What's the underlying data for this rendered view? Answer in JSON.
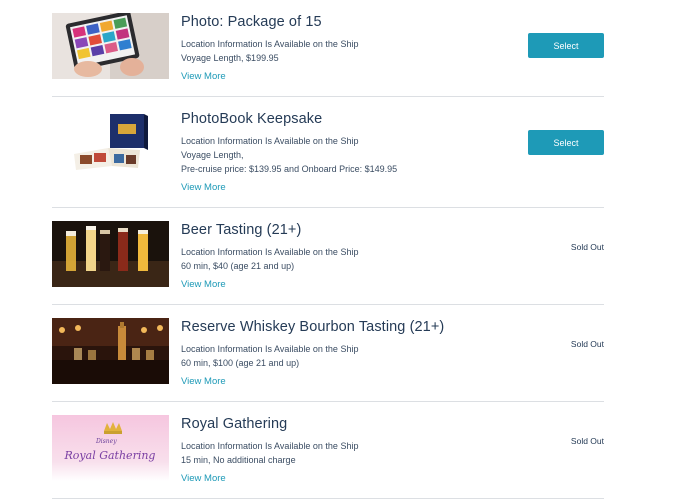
{
  "items": [
    {
      "title": "Photo: Package of 15",
      "location": "Location Information Is Available on the Ship",
      "detail1": "Voyage Length, $199.95",
      "view_more": "View More",
      "action": "Select",
      "thumb_icon": "tablet-photos-image"
    },
    {
      "title": "PhotoBook Keepsake",
      "location": "Location Information Is Available on the Ship",
      "detail1": "Voyage Length,",
      "detail2": "Pre-cruise price: $139.95 and Onboard Price: $149.95",
      "view_more": "View More",
      "action": "Select",
      "thumb_icon": "photobook-image"
    },
    {
      "title": "Beer Tasting (21+)",
      "location": "Location Information Is Available on the Ship",
      "detail1": "60 min, $40 (age 21 and up)",
      "view_more": "View More",
      "status": "Sold Out",
      "thumb_icon": "beer-glasses-image"
    },
    {
      "title": "Reserve Whiskey Bourbon Tasting (21+)",
      "location": "Location Information Is Available on the Ship",
      "detail1": "60 min, $100 (age 21 and up)",
      "view_more": "View More",
      "status": "Sold Out",
      "thumb_icon": "whiskey-bar-image"
    },
    {
      "title": "Royal Gathering",
      "location": "Location Information Is Available on the Ship",
      "detail1": "15 min, No additional charge",
      "view_more": "View More",
      "status": "Sold Out",
      "thumb_icon": "royal-gathering-logo-image",
      "thumb_text_brand": "Disney",
      "thumb_text_logo": "Royal Gathering"
    }
  ],
  "colors": {
    "accent": "#1e9ab7",
    "title": "#253b56",
    "divider": "#dcdfe3"
  }
}
